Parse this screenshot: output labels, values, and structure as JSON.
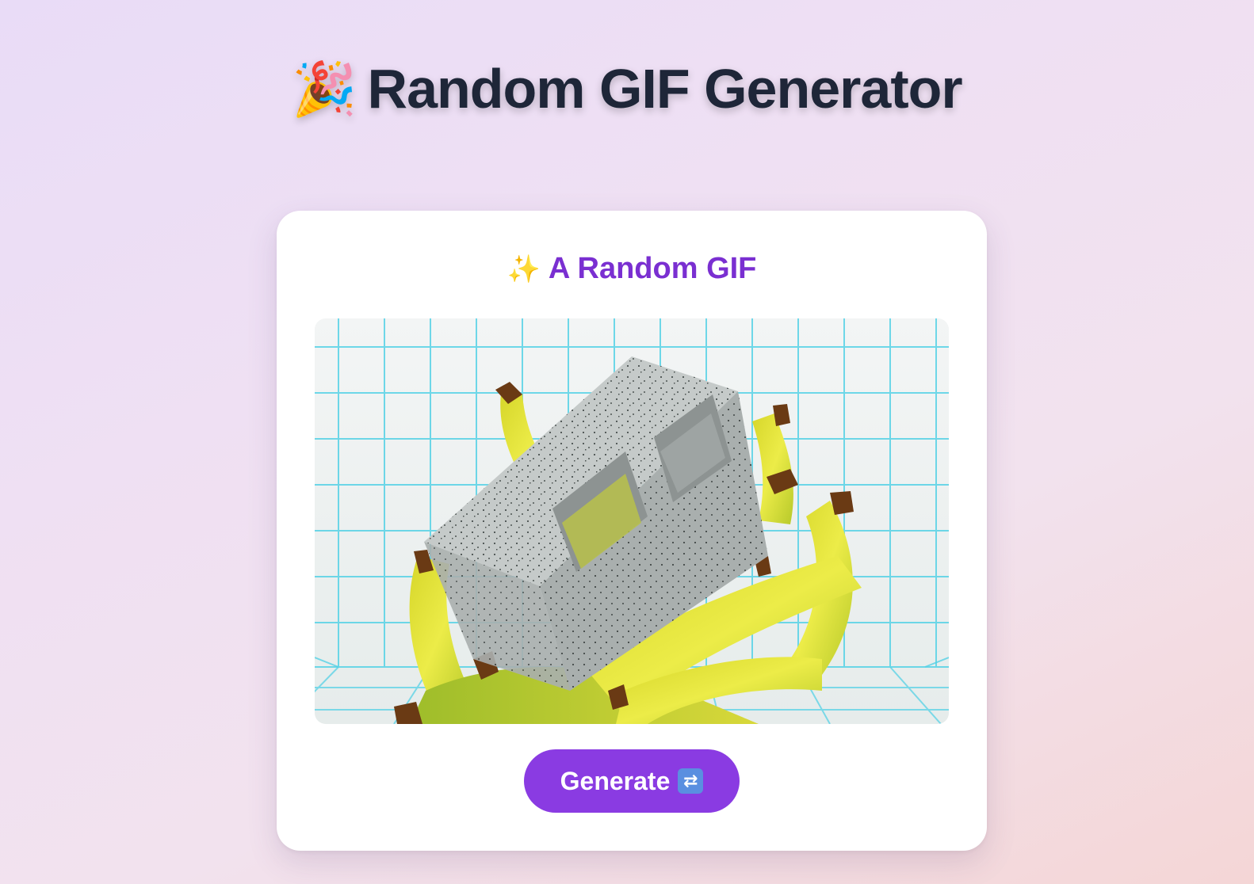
{
  "header": {
    "emoji": "🎉",
    "title": "Random GIF Generator"
  },
  "card": {
    "heading_emoji": "✨",
    "heading": "A Random GIF",
    "gif": {
      "content": "cinder-block-and-bananas-animation"
    },
    "button": {
      "label": "Generate",
      "icon": "repeat-icon"
    }
  },
  "colors": {
    "title": "#1e2638",
    "heading": "#7a2fd1",
    "button": "#8a3be2",
    "card": "#ffffff"
  }
}
